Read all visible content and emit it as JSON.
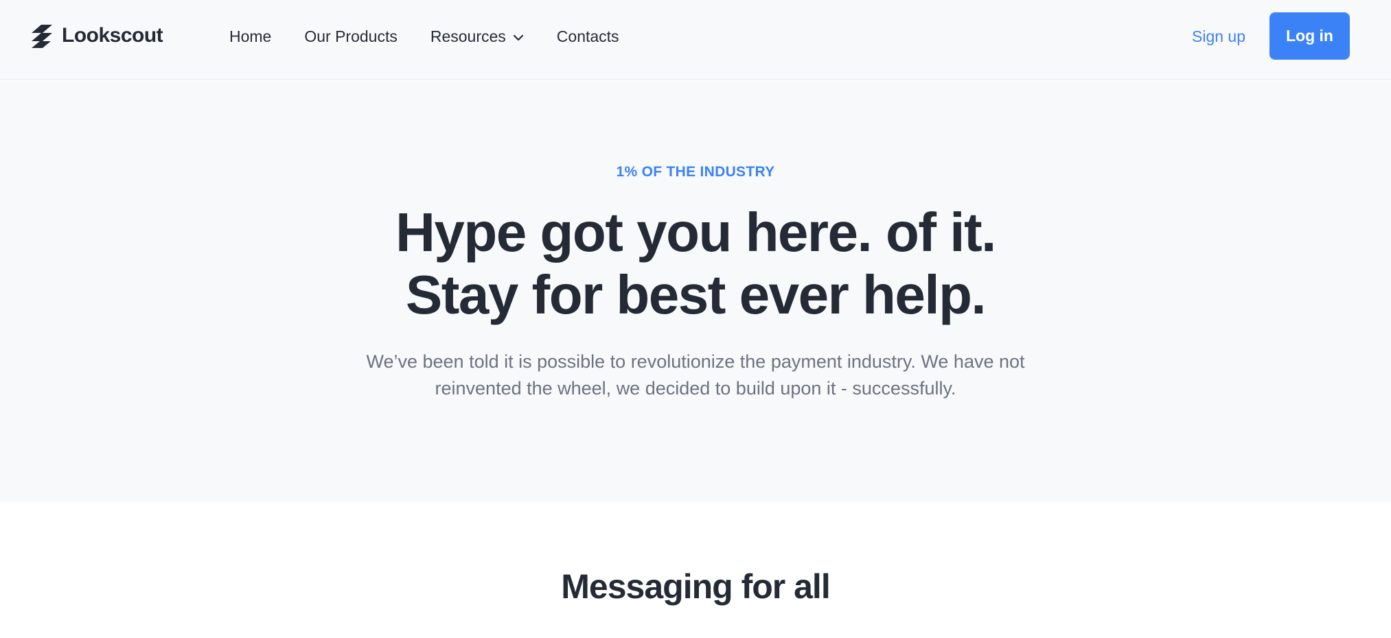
{
  "header": {
    "logo_text": "Lookscout",
    "nav": [
      {
        "label": "Home"
      },
      {
        "label": "Our Products"
      },
      {
        "label": "Resources",
        "has_dropdown": true
      },
      {
        "label": "Contacts"
      }
    ],
    "signup_label": "Sign up",
    "login_label": "Log in"
  },
  "hero": {
    "eyebrow": "1% OF THE INDUSTRY",
    "headline_line1": "Hype got you here. of it.",
    "headline_line2": "Stay for best ever help.",
    "subtext_line1": "We’ve been told it is possible to revolutionize the payment industry. We have not",
    "subtext_line2": "reinvented the wheel, we decided to build upon it - successfully."
  },
  "section": {
    "title": "Messaging for all"
  },
  "colors": {
    "accent": "#3b82f6",
    "text_dark": "#252b36",
    "text_muted": "#6b7280",
    "hero_bg": "#f8f9fb"
  },
  "icons": {
    "logo": "stacked-slash-logo-icon",
    "dropdown": "chevron-down-icon"
  }
}
